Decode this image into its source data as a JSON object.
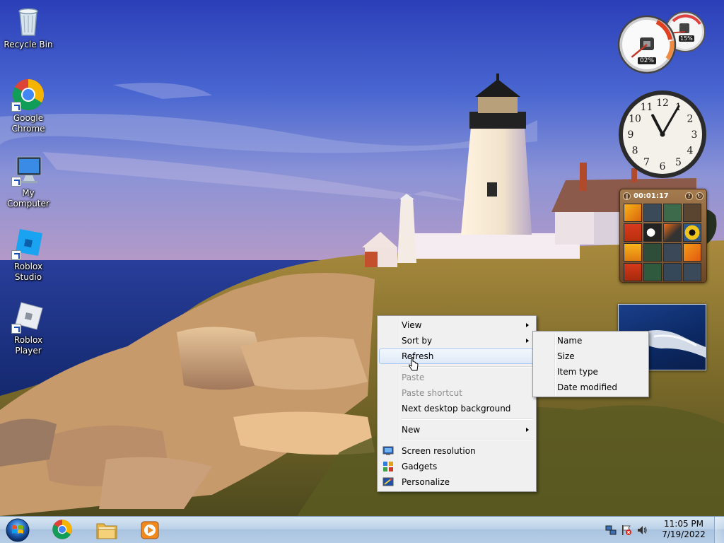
{
  "desktop": {
    "icons": [
      {
        "label": "Recycle Bin",
        "icon": "recycle-bin-icon"
      },
      {
        "label": "Google\nChrome",
        "icon": "chrome-icon"
      },
      {
        "label": "My Computer",
        "icon": "computer-icon"
      },
      {
        "label": "Roblox Studio",
        "icon": "roblox-studio-icon"
      },
      {
        "label": "Roblox Player",
        "icon": "roblox-player-icon"
      }
    ]
  },
  "gadgets": {
    "cpu_meter": {
      "cpu_percent": "02%",
      "memory_percent": "15%",
      "cpu_value": 2,
      "memory_value": 15
    },
    "clock": {
      "hour": 11,
      "minute": 5,
      "numerals": [
        "12",
        "1",
        "2",
        "3",
        "4",
        "5",
        "6",
        "7",
        "8",
        "9",
        "10",
        "11"
      ]
    },
    "puzzle": {
      "timer": "00:01:17"
    }
  },
  "context_menu": {
    "items": [
      {
        "label": "View",
        "submenu": true,
        "enabled": true
      },
      {
        "label": "Sort by",
        "submenu": true,
        "enabled": true
      },
      {
        "label": "Refresh",
        "submenu": false,
        "enabled": true,
        "highlighted": true
      },
      {
        "label": "Paste",
        "enabled": false
      },
      {
        "label": "Paste shortcut",
        "enabled": false
      },
      {
        "label": "Next desktop background",
        "enabled": true
      },
      {
        "label": "New",
        "submenu": true,
        "enabled": true
      },
      {
        "label": "Screen resolution",
        "enabled": true,
        "icon": "screen-resolution-icon"
      },
      {
        "label": "Gadgets",
        "enabled": true,
        "icon": "gadgets-icon"
      },
      {
        "label": "Personalize",
        "enabled": true,
        "icon": "personalize-icon"
      }
    ]
  },
  "sort_submenu": {
    "items": [
      {
        "label": "Name"
      },
      {
        "label": "Size"
      },
      {
        "label": "Item type"
      },
      {
        "label": "Date modified"
      }
    ]
  },
  "taskbar": {
    "pinned": [
      {
        "name": "chrome",
        "icon": "chrome-icon"
      },
      {
        "name": "file-explorer",
        "icon": "folder-icon"
      },
      {
        "name": "media-player",
        "icon": "media-player-icon"
      }
    ],
    "clock": {
      "time": "11:05 PM",
      "date": "7/19/2022"
    }
  },
  "colors": {
    "taskbar": "#bcd2e8",
    "menu_background": "#f0f0f0",
    "menu_highlight_border": "#a8c8ef",
    "disabled_text": "#8d8d8d"
  }
}
